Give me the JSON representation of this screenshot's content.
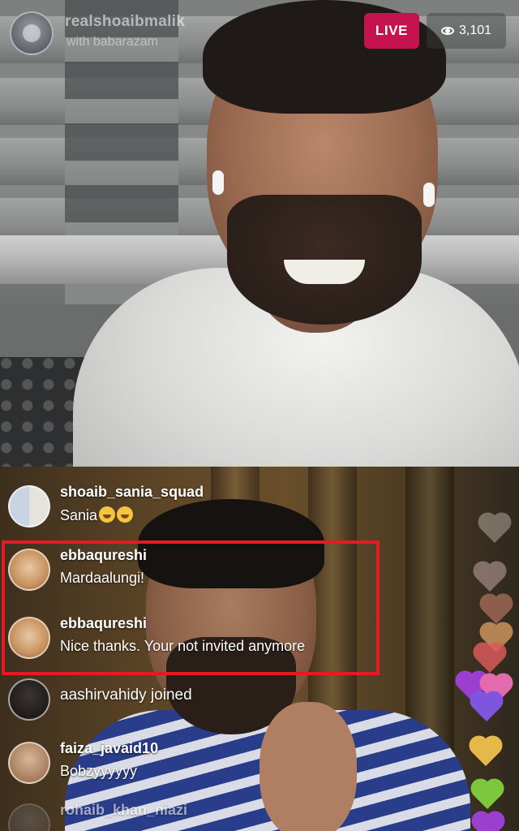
{
  "header": {
    "host_username": "realshoaibmalik",
    "guest_line": "with babarazam",
    "live_label": "LIVE",
    "viewer_count": "3,101"
  },
  "comments": [
    {
      "username": "shoaib_sania_squad",
      "text": "Sania",
      "emoji_count": 2,
      "avatar": "couple-avatar"
    },
    {
      "username": "ebbaqureshi",
      "text": "Mardaalungi!",
      "avatar": "woman-avatar"
    },
    {
      "username": "ebbaqureshi",
      "text": "Nice thanks. Your not invited anymore",
      "avatar": "woman-avatar"
    },
    {
      "joined_text": "aashirvahidy joined",
      "avatar": "man-avatar"
    },
    {
      "username": "faiza_javaid10",
      "text": "Bobzyyyyyy",
      "avatar": "woman-avatar"
    },
    {
      "username": "rohaib_khan_niazi",
      "avatar": "faded-avatar"
    }
  ],
  "colors": {
    "live_badge": "#c4134f",
    "highlight_border": "#e51b23",
    "hearts": [
      "#f3ede0",
      "#e0c0c0",
      "#c9806a",
      "#d59a60",
      "#d85a5a",
      "#9b3fd0",
      "#e46ab0",
      "#7f55e0",
      "#e5b84a",
      "#7bc83c",
      "#9b3fd0"
    ]
  }
}
